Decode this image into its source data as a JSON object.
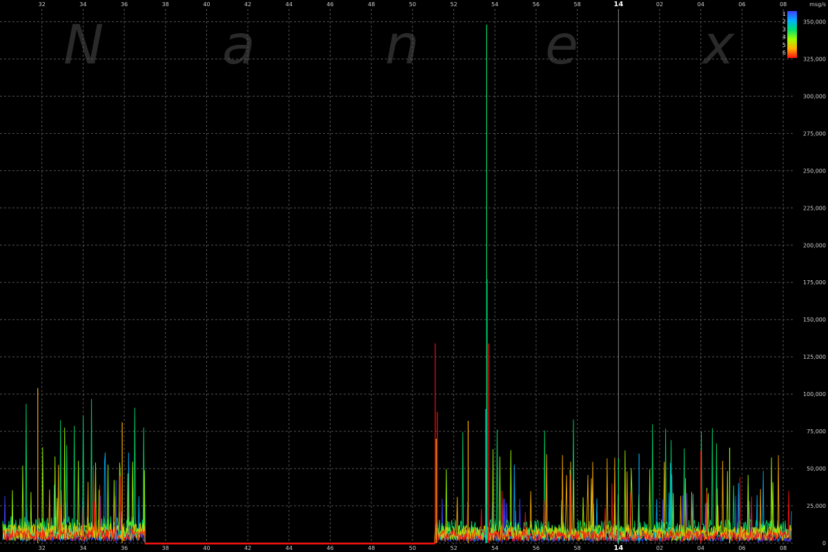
{
  "chart_data": {
    "type": "line",
    "watermark": [
      "N",
      "a",
      "n",
      "e",
      "x"
    ],
    "unit_label": "msg/s",
    "legend": [
      "1",
      "2",
      "3",
      "4",
      "5",
      "6"
    ],
    "colors": {
      "1": "#4040ff",
      "2": "#00b0ff",
      "3": "#00e070",
      "4": "#a0ff00",
      "5": "#ffb000",
      "6": "#ff1010",
      "grid": "#555555",
      "hour_line": "#8a8a8a",
      "baseline": "#ff1010"
    },
    "x_ticks": [
      {
        "label": "32",
        "min": 32
      },
      {
        "label": "34",
        "min": 34
      },
      {
        "label": "36",
        "min": 36
      },
      {
        "label": "38",
        "min": 38
      },
      {
        "label": "40",
        "min": 40
      },
      {
        "label": "42",
        "min": 42
      },
      {
        "label": "44",
        "min": 44
      },
      {
        "label": "46",
        "min": 46
      },
      {
        "label": "48",
        "min": 48
      },
      {
        "label": "50",
        "min": 50
      },
      {
        "label": "52",
        "min": 52
      },
      {
        "label": "54",
        "min": 54
      },
      {
        "label": "56",
        "min": 56
      },
      {
        "label": "58",
        "min": 58
      },
      {
        "label": "14",
        "min": 60,
        "bold": true
      },
      {
        "label": "02",
        "min": 62
      },
      {
        "label": "04",
        "min": 64
      },
      {
        "label": "06",
        "min": 66
      },
      {
        "label": "08",
        "min": 68
      }
    ],
    "xlim": [
      30.1,
      68.5
    ],
    "y_ticks": [
      0,
      25000,
      50000,
      75000,
      100000,
      125000,
      150000,
      175000,
      200000,
      225000,
      250000,
      275000,
      300000,
      325000,
      350000
    ],
    "y_tick_labels": [
      "0",
      "25,000",
      "50,000",
      "75,000",
      "100,000",
      "125,000",
      "150,000",
      "175,000",
      "200,000",
      "225,000",
      "250,000",
      "275,000",
      "300,000",
      "325,000",
      "350,000"
    ],
    "ylim": [
      0,
      353000
    ],
    "grid": true,
    "legend_position": "top-right",
    "gap": [
      37.0,
      51.1
    ],
    "spikes": [
      {
        "series": "5",
        "x": 31.8,
        "y": 104000
      },
      {
        "series": "5",
        "x": 35.9,
        "y": 81000
      },
      {
        "series": "6",
        "x": 51.1,
        "y": 134000
      },
      {
        "series": "6",
        "x": 51.2,
        "y": 88000
      },
      {
        "series": "5",
        "x": 51.15,
        "y": 70000
      },
      {
        "series": "5",
        "x": 52.7,
        "y": 82000
      },
      {
        "series": "3",
        "x": 53.6,
        "y": 348000
      },
      {
        "series": "3",
        "x": 53.62,
        "y": 177000
      },
      {
        "series": "6",
        "x": 53.7,
        "y": 134000
      },
      {
        "series": "2",
        "x": 53.55,
        "y": 90000
      },
      {
        "series": "1",
        "x": 35.6,
        "y": 42000
      },
      {
        "series": "4",
        "x": 65.4,
        "y": 64000
      },
      {
        "series": "6",
        "x": 64.0,
        "y": 62000
      },
      {
        "series": "3",
        "x": 60.0,
        "y": 57000
      },
      {
        "series": "2",
        "x": 61.0,
        "y": 60000
      }
    ]
  }
}
